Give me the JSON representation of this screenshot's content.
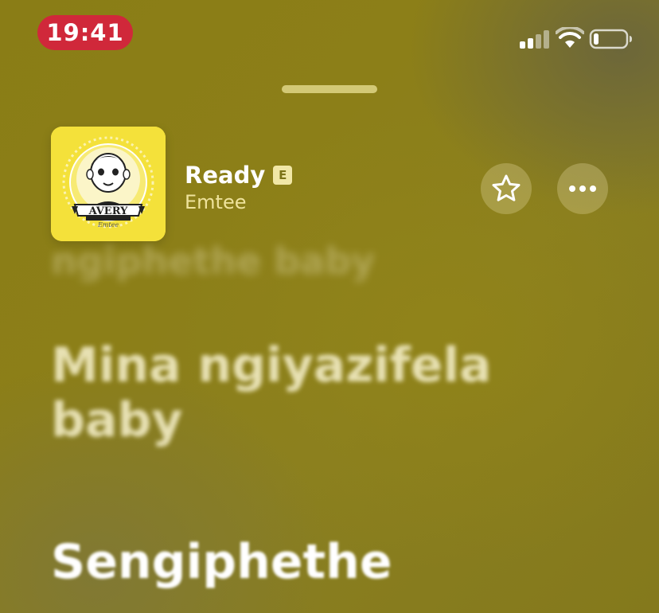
{
  "status_bar": {
    "time": "19:41",
    "signal_icon": "cellular-signal-icon",
    "wifi_icon": "wifi-icon",
    "battery_icon": "battery-low-icon",
    "time_pill_color": "#d0283a"
  },
  "now_playing": {
    "title": "Ready",
    "explicit_badge": "E",
    "artist": "Emtee",
    "artwork_icon": "album-art-avery",
    "artwork_text": "AVERY",
    "artwork_signature": "Emtee",
    "favorite_icon": "star-icon",
    "more_icon": "ellipsis-icon"
  },
  "lyrics": {
    "previous_line": "ngiphethe baby",
    "line_1": "Mina ngiyazifela baby",
    "line_2": "Sengiphethe"
  },
  "colors": {
    "background": "#8a7d16",
    "artwork_background": "#f4e13a",
    "accent_text": "#efe39c"
  }
}
